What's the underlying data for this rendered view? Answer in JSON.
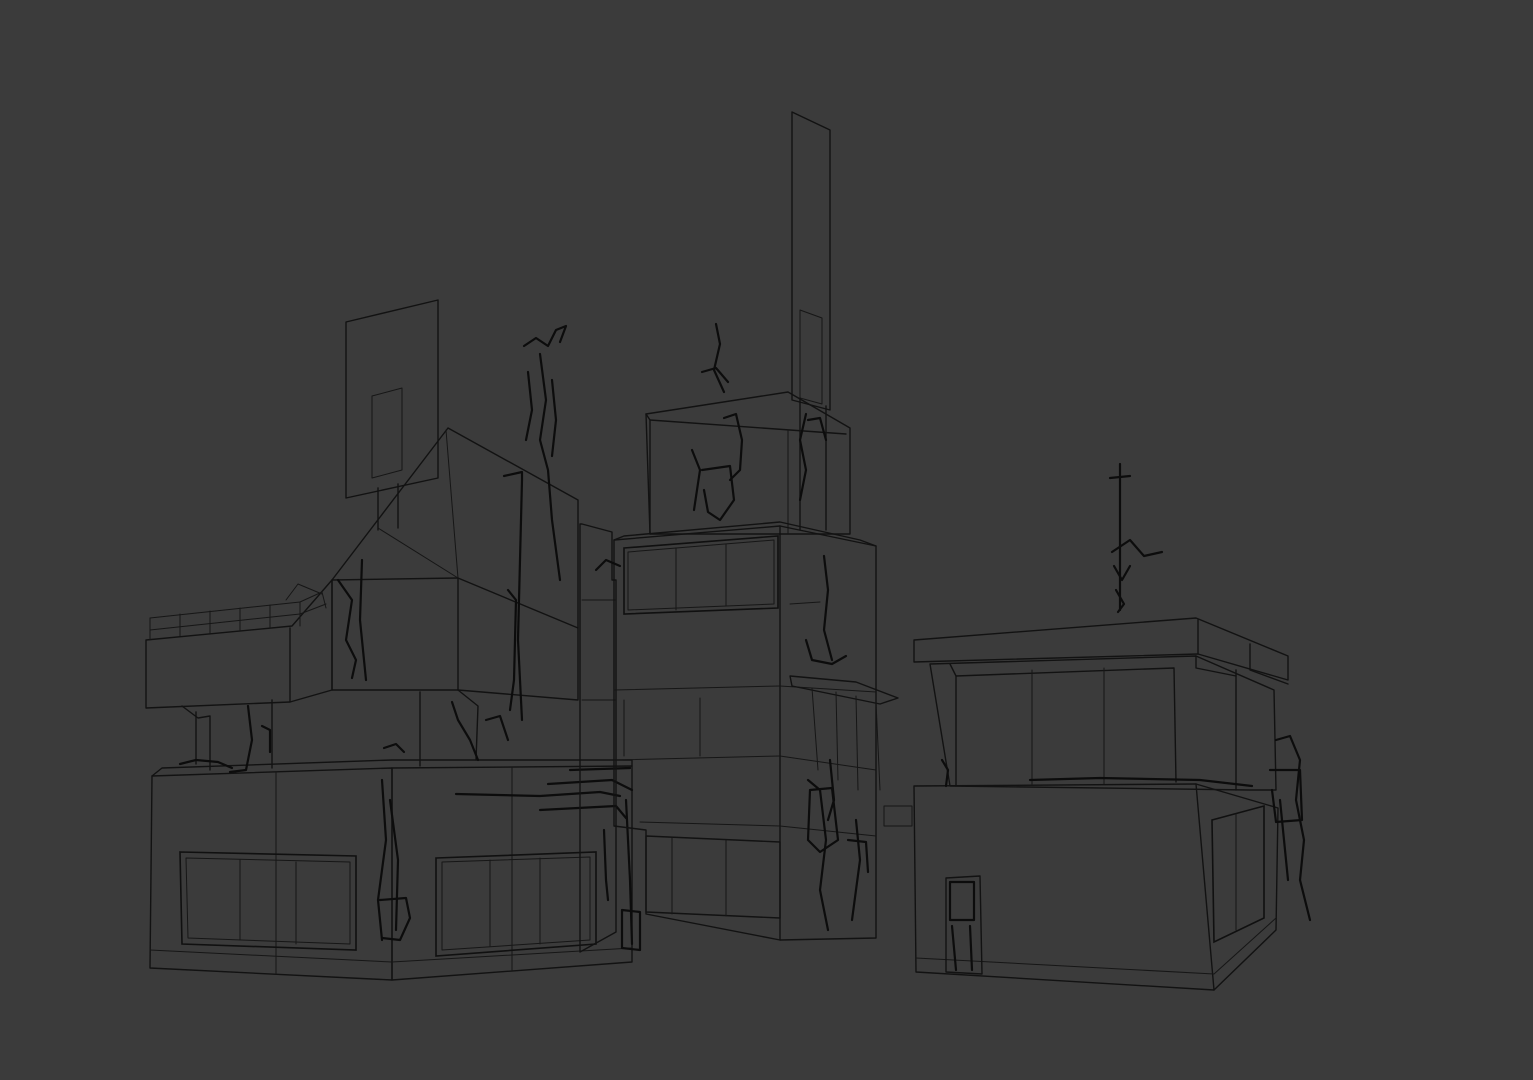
{
  "viewport": {
    "background": "#3b3b3b",
    "wire_color": "#121212",
    "render_mode": "wireframe"
  },
  "scene": {
    "objects": [
      "building-left",
      "building-center",
      "building-right"
    ]
  }
}
